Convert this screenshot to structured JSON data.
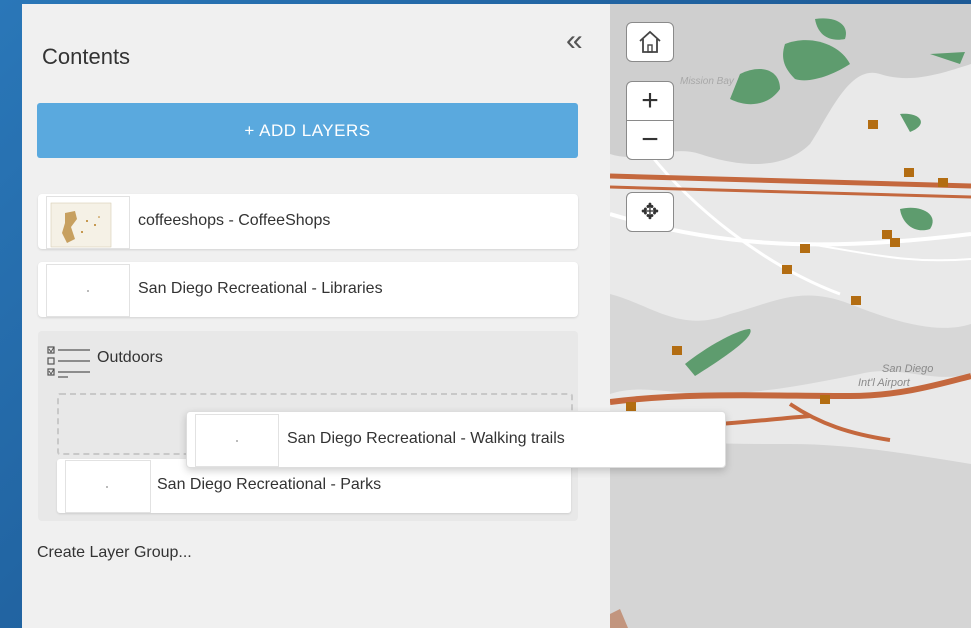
{
  "panel": {
    "title": "Contents",
    "collapse_icon": "double-chevron-left-icon",
    "add_layers_label": "+ ADD LAYERS",
    "layers": [
      {
        "label": "coffeeshops - CoffeeShops"
      },
      {
        "label": "San Diego Recreational - Libraries"
      }
    ],
    "group": {
      "label": "Outdoors",
      "icon": "layer-group-icon",
      "children": [
        {
          "label": "San Diego Recreational - Parks"
        }
      ]
    },
    "dragging_layer": {
      "label": "San Diego Recreational - Walking trails"
    },
    "create_group_label": "Create Layer Group..."
  },
  "map": {
    "labels": {
      "airport_line1": "San Diego",
      "airport_line2": "Int'l Airport",
      "bay": "Mission Bay"
    },
    "controls": {
      "home_icon": "home-icon",
      "zoom_in_label": "+",
      "zoom_out_label": "−",
      "pan_icon": "move-arrows-icon"
    }
  },
  "colors": {
    "add_button": "#5aa9de",
    "panel_bg": "#f0f0f0",
    "park_green": "#5e9c6e",
    "road_orange": "#c4683e",
    "coffee_brown": "#b36d12"
  }
}
